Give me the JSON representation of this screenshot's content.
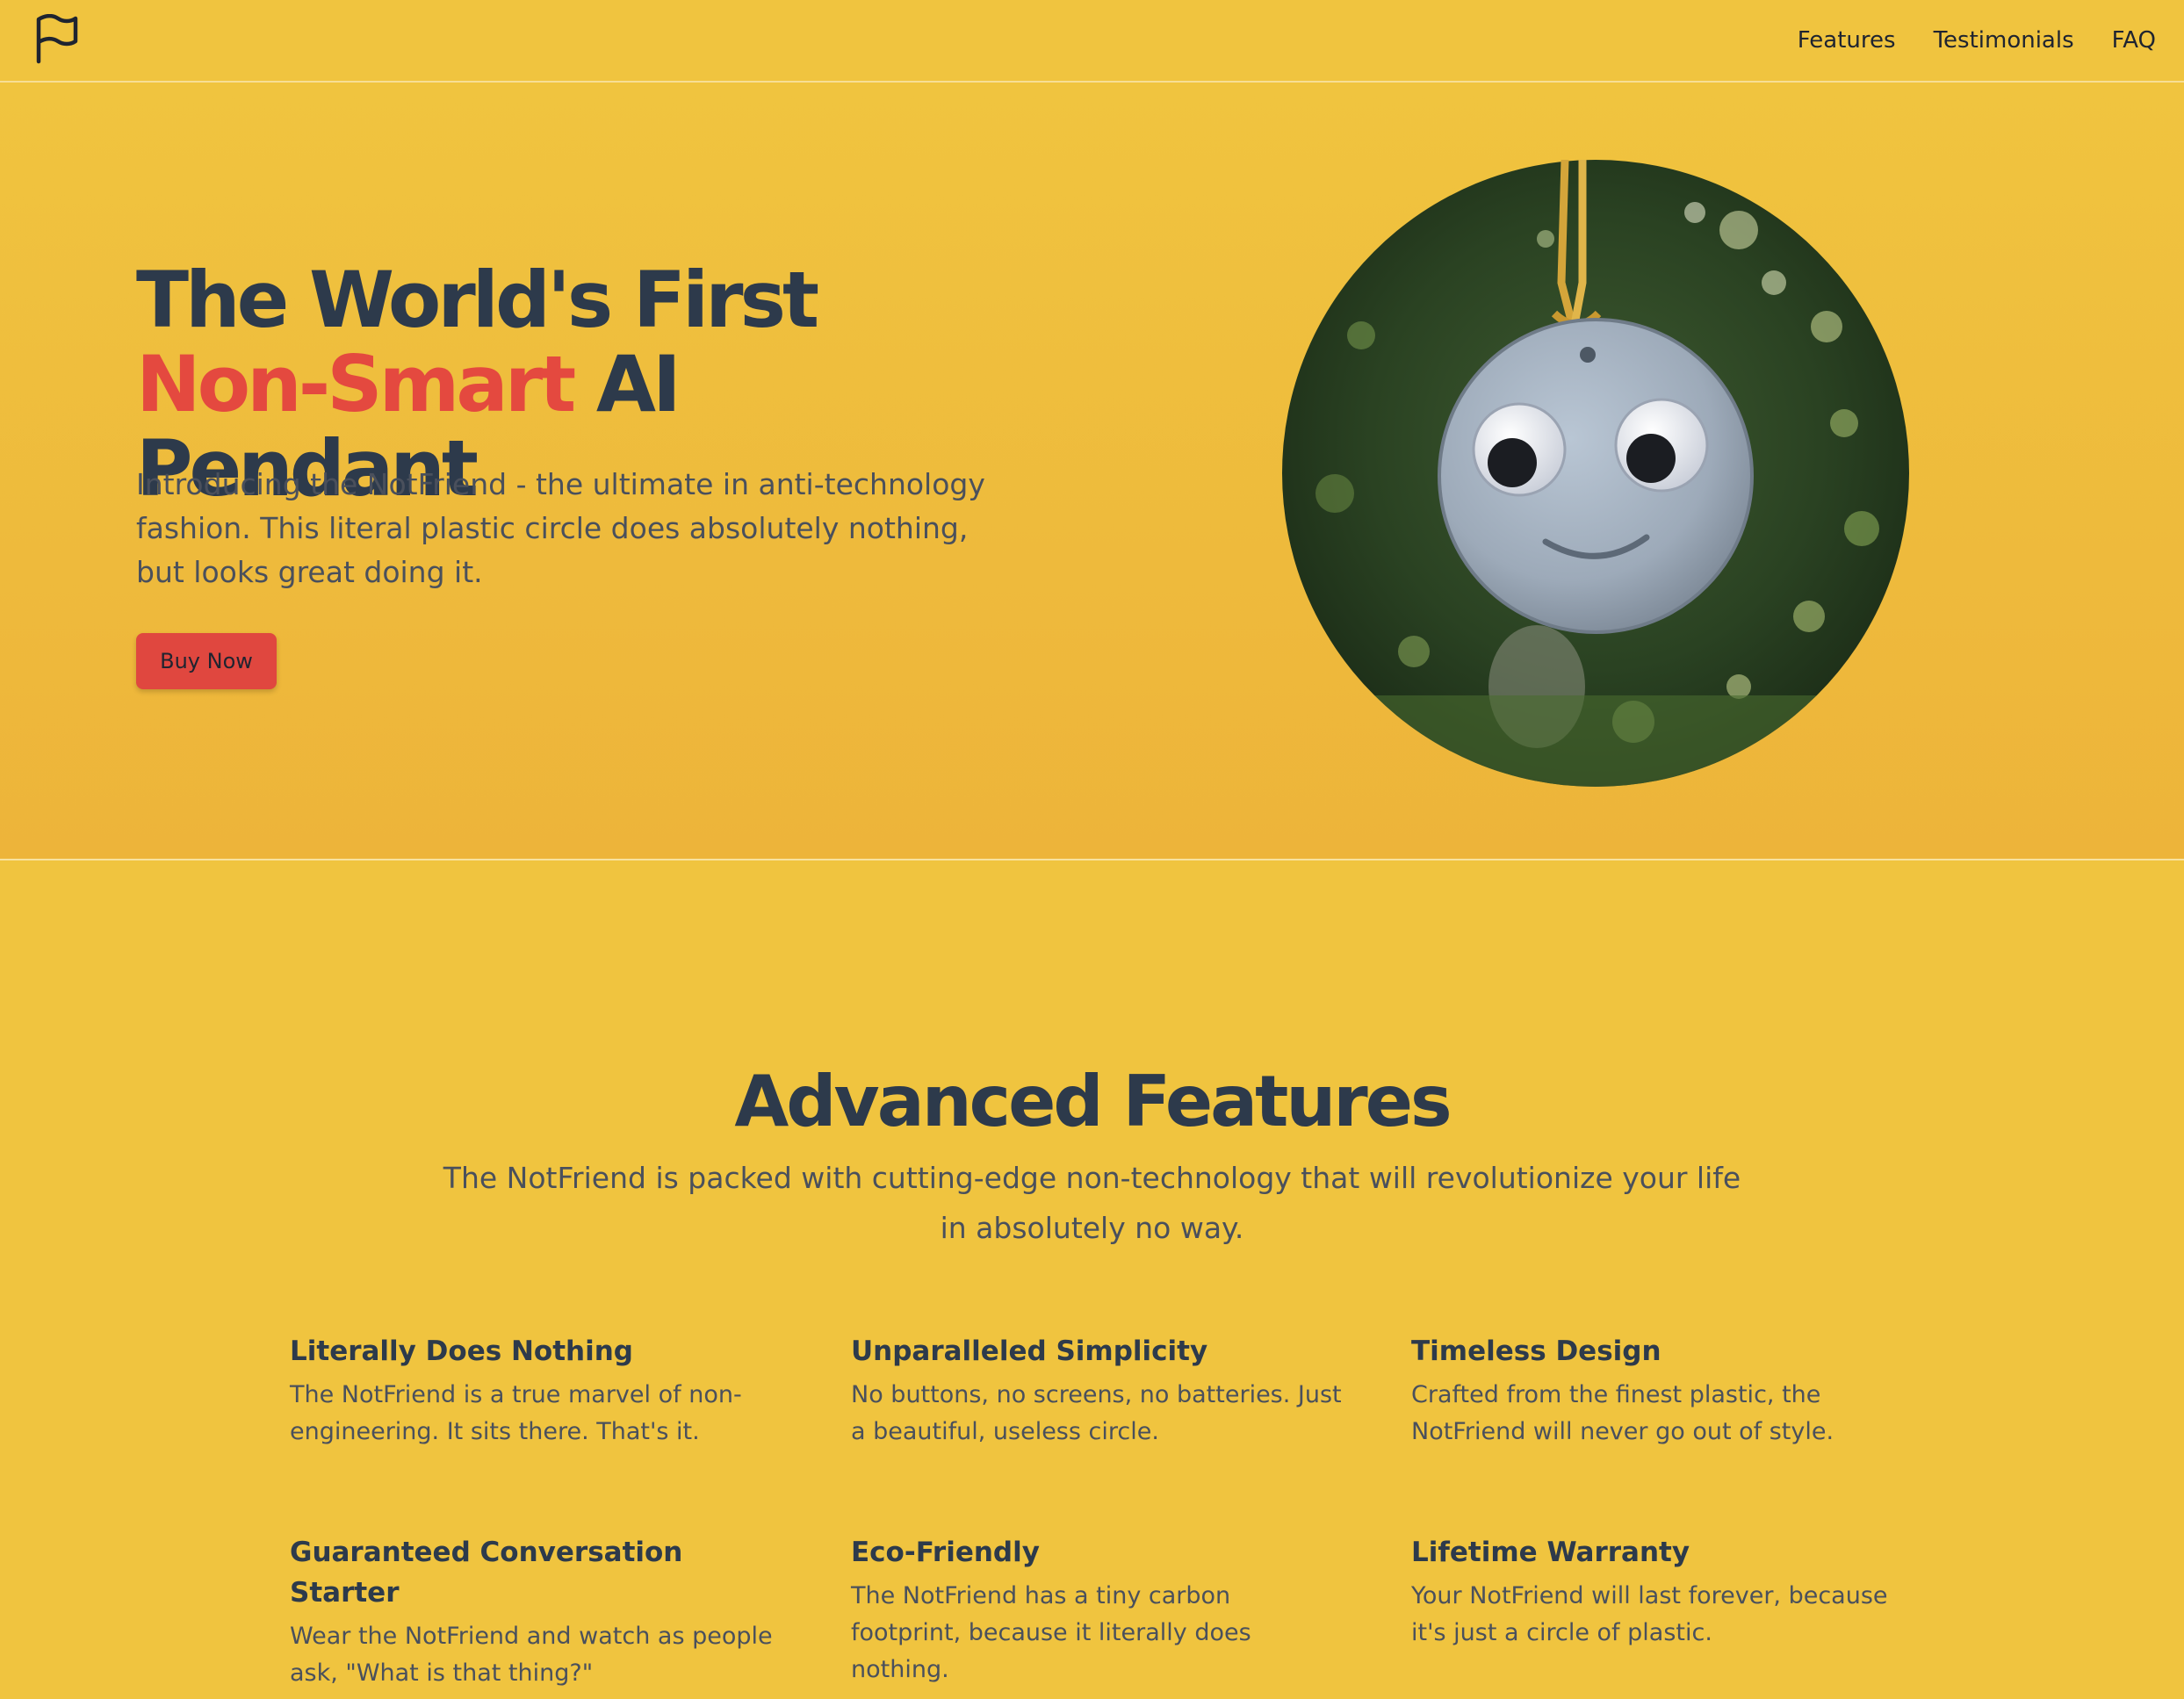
{
  "nav": {
    "logo_icon": "flag-icon",
    "links": [
      "Features",
      "Testimonials",
      "FAQ"
    ]
  },
  "hero": {
    "title_part1": "The World's First ",
    "title_accent": "Non-Smart",
    "title_part2": " AI Pendant",
    "subtitle": "Introducing the NotFriend - the ultimate in anti-technology fashion. This literal plastic circle does absolutely nothing, but looks great doing it.",
    "cta_label": "Buy Now"
  },
  "features": {
    "title": "Advanced Features",
    "subtitle": "The NotFriend is packed with cutting-edge non-technology that will revolutionize your life in absolutely no way.",
    "items": [
      {
        "title": "Literally Does Nothing",
        "text": "The NotFriend is a true marvel of non-engineering. It sits there. That's it."
      },
      {
        "title": "Unparalleled Simplicity",
        "text": "No buttons, no screens, no batteries. Just a beautiful, useless circle."
      },
      {
        "title": "Timeless Design",
        "text": "Crafted from the finest plastic, the NotFriend will never go out of style."
      },
      {
        "title": "Guaranteed Conversation Starter",
        "text": "Wear the NotFriend and watch as people ask, \"What is that thing?\""
      },
      {
        "title": "Eco-Friendly",
        "text": "The NotFriend has a tiny carbon footprint, because it literally does nothing."
      },
      {
        "title": "Lifetime Warranty",
        "text": "Your NotFriend will last forever, because it's just a circle of plastic."
      }
    ]
  },
  "colors": {
    "background": "#F0C43F",
    "accent": "#E4493F",
    "heading": "#2D3A4B",
    "body_text": "#4A505C"
  }
}
